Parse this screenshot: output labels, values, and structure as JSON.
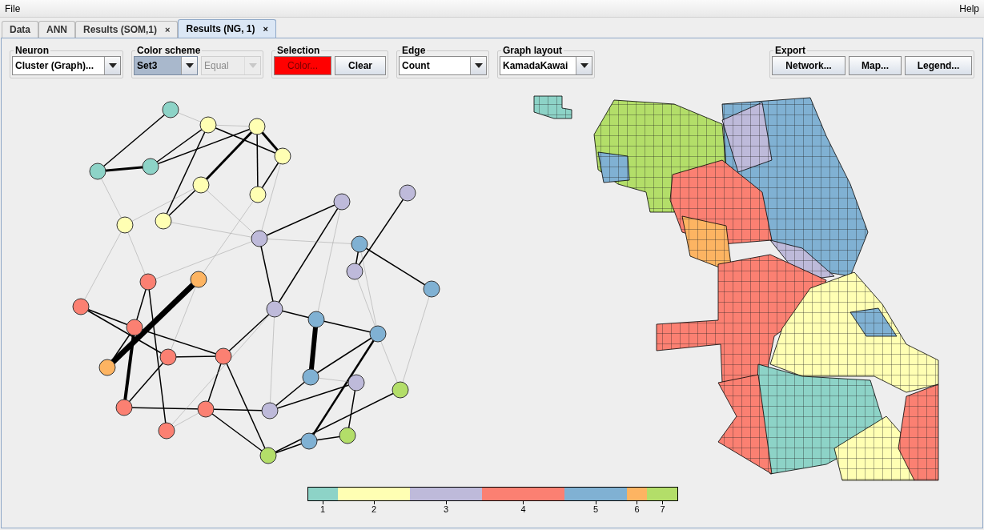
{
  "menu": [
    {
      "label": "File"
    },
    {
      "label": "Help"
    }
  ],
  "tabs": [
    {
      "label": "Data",
      "selected": false,
      "closable": false
    },
    {
      "label": "ANN",
      "selected": false,
      "closable": false
    },
    {
      "label": "Results (SOM,1)",
      "selected": false,
      "closable": true,
      "close": "×"
    },
    {
      "label": "Results (NG, 1)",
      "selected": true,
      "closable": true,
      "close": "×"
    }
  ],
  "toolbar": [
    {
      "title": "Neuron",
      "controls": [
        {
          "kind": "dropdown",
          "value": "Cluster (Graph)...",
          "disabled": false,
          "focused": false
        }
      ]
    },
    {
      "title": "Color scheme",
      "controls": [
        {
          "kind": "dropdown",
          "value": "Set3",
          "disabled": false,
          "focused": true
        },
        {
          "kind": "dropdown",
          "value": "Equal",
          "disabled": true,
          "focused": false
        }
      ]
    },
    {
      "title": "Selection",
      "controls": [
        {
          "kind": "color-button",
          "label": "Color...",
          "color": "#ff0000"
        },
        {
          "kind": "button",
          "label": "Clear"
        }
      ]
    },
    {
      "title": "Edge",
      "controls": [
        {
          "kind": "dropdown",
          "value": "Count",
          "disabled": false,
          "focused": false
        }
      ]
    },
    {
      "title": "Graph layout",
      "controls": [
        {
          "kind": "dropdown",
          "value": "KamadaKawai",
          "disabled": false,
          "focused": false
        }
      ]
    },
    {
      "title": "Export",
      "controls": [
        {
          "kind": "button",
          "label": "Network..."
        },
        {
          "kind": "button",
          "label": "Map..."
        },
        {
          "kind": "button",
          "label": "Legend..."
        }
      ]
    }
  ],
  "legend": [
    {
      "label": "1",
      "color": "#8dd3c7"
    },
    {
      "label": "2",
      "color": "#ffffb3"
    },
    {
      "label": "3",
      "color": "#bebada"
    },
    {
      "label": "4",
      "color": "#fb8072"
    },
    {
      "label": "5",
      "color": "#80b1d3"
    },
    {
      "label": "6",
      "color": "#fdb462"
    },
    {
      "label": "7",
      "color": "#b3de69"
    }
  ]
}
